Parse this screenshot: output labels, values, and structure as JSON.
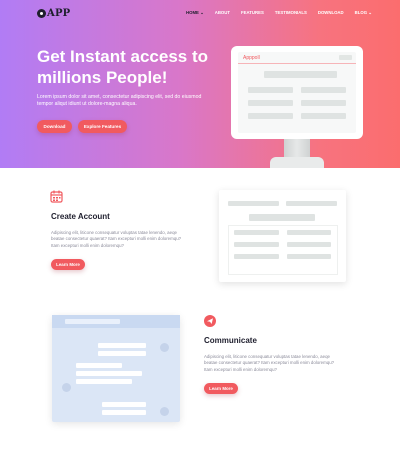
{
  "brand": {
    "logo_text": "APP"
  },
  "nav": {
    "items": [
      "HOME",
      "ABOUT",
      "FEATURES",
      "TESTIMONIALS",
      "DOWNLOAD",
      "BLOG"
    ]
  },
  "hero": {
    "title": "Get Instant access to millions People!",
    "text": "Lorem ipsum dolor sit amet, consectetur adipiscing elit, sed do eiusmod tempor aliqut idiunt ut dolore-magna aliqua.",
    "download_label": "Download",
    "explore_label": "Explore Features",
    "screen_title": "Apppoll"
  },
  "section1": {
    "title": "Create Account",
    "text": "Adipiscing elit, liticone consequatur voluptas tatae lenendo, aeqe beatae consectetur quaerat? Itam excepturi molli enim doloremqu? Itam excepturi molli enim doloremqu?",
    "button": "Learn More"
  },
  "section2": {
    "title": "Communicate",
    "text": "Adipiscing elit, liticone consequatur voluptas tatae lenendo, aeqe beatae consectetur quaerat? Itam excepturi molli enim doloremqu? Itam excepturi molli enim doloremqu?",
    "button": "Learn More"
  },
  "colors": {
    "accent": "#f15a5f",
    "gradient_start": "#b17cf5",
    "gradient_end": "#fb6d6e"
  },
  "icons": {
    "section1": "calendar-icon",
    "section2": "send-icon"
  }
}
